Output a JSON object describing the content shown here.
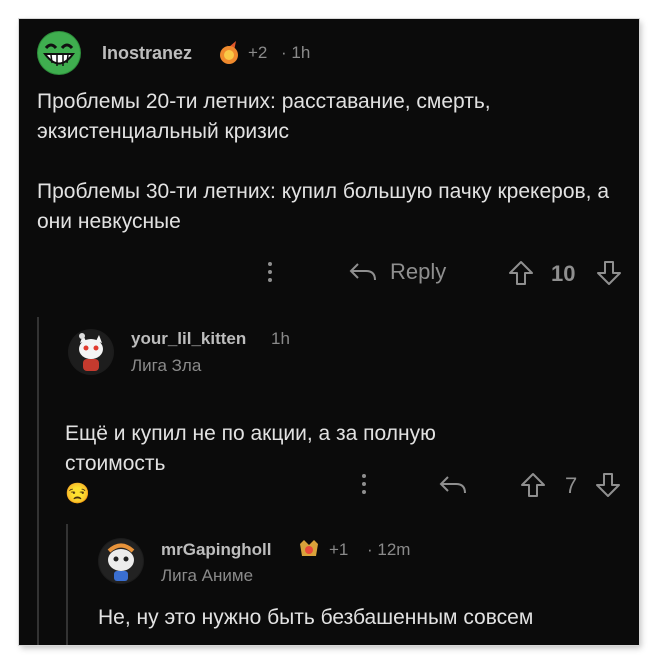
{
  "comments": [
    {
      "author": "Inostranez",
      "award_count": "+2",
      "time": "· 1h",
      "body": "Проблемы 20-ти летних: расставание, смерть, экзистенциальный кризис\n\nПроблемы 30-ти летних: купил большую пачку крекеров, а они невкусные",
      "reply_label": "Reply",
      "score": "10"
    },
    {
      "author": "your_lil_kitten",
      "time": "1h",
      "flair": "Лига Зла",
      "body": "Ещё и купил не по акции, а за полную стоимость",
      "emoji": "😒",
      "score": "7"
    },
    {
      "author": "mrGapingholl",
      "award_count": "+1",
      "time": "· 12m",
      "flair": "Лига Аниме",
      "body": "Не, ну это нужно быть безбашенным совсем"
    }
  ],
  "colors": {
    "background": "#0b0b0b",
    "text": "#e2e2e2",
    "muted": "#8a8a8a"
  }
}
